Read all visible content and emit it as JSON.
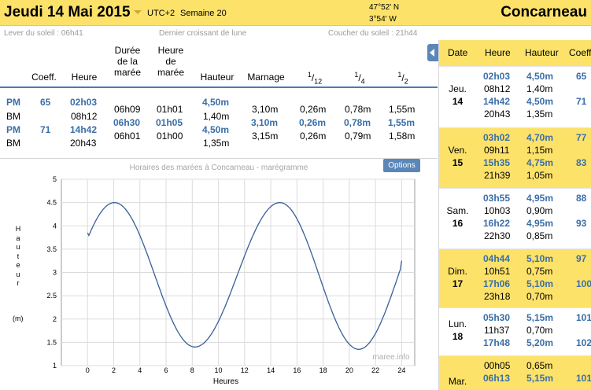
{
  "header": {
    "date": "Jeudi 14 Mai 2015",
    "timezone": "UTC+2",
    "week": "Semaine 20",
    "lat": "47°52' N",
    "lon": "3°54' W",
    "city": "Concarneau"
  },
  "sun": {
    "sunrise": "Lever du soleil : 06h41",
    "moon": "Dernier croissant de lune",
    "sunset": "Coucher du soleil : 21h44"
  },
  "table": {
    "headers": {
      "coeff": "Coeff.",
      "heure": "Heure",
      "duree": [
        "Durée",
        "de la",
        "marée"
      ],
      "heure_maree": [
        "Heure",
        "de",
        "marée"
      ],
      "hauteur": "Hauteur",
      "marnage": "Marnage",
      "f12": [
        "1",
        "12"
      ],
      "f14": [
        "1",
        "4"
      ],
      "f12b": [
        "1",
        "2"
      ]
    },
    "rows": [
      {
        "type": "PM",
        "coeff": "65",
        "heure": "02h03",
        "duree": "06h09",
        "heure_maree": "01h01",
        "hauteur": "4,50m",
        "marnage": "3,10m",
        "d12": "0,26m",
        "d4": "0,78m",
        "d2": "1,55m"
      },
      {
        "type": "BM",
        "coeff": "",
        "heure": "08h12",
        "duree": "06h30",
        "heure_maree": "01h05",
        "hauteur": "1,40m",
        "marnage": "3,10m",
        "d12": "0,26m",
        "d4": "0,78m",
        "d2": "1,55m"
      },
      {
        "type": "PM",
        "coeff": "71",
        "heure": "14h42",
        "duree": "06h01",
        "heure_maree": "01h00",
        "hauteur": "4,50m",
        "marnage": "3,15m",
        "d12": "0,26m",
        "d4": "0,79m",
        "d2": "1,58m"
      },
      {
        "type": "BM",
        "coeff": "",
        "heure": "20h43",
        "duree": "",
        "heure_maree": "",
        "hauteur": "1,35m",
        "marnage": "",
        "d12": "",
        "d4": "",
        "d2": ""
      }
    ]
  },
  "chart": {
    "title": "Horaires des marées à Concarneau - marégramme",
    "options_label": "Options",
    "watermark": "maree.info"
  },
  "chart_data": {
    "type": "line",
    "title": "Horaires des marées à Concarneau - marégramme",
    "xlabel": "Heures",
    "ylabel": "Hauteur (m)",
    "xlim": [
      -2,
      25
    ],
    "ylim": [
      1,
      5
    ],
    "xticks": [
      0,
      2,
      4,
      6,
      8,
      10,
      12,
      14,
      16,
      18,
      20,
      22,
      24
    ],
    "yticks": [
      1,
      1.5,
      2,
      2.5,
      3,
      3.5,
      4,
      4.5,
      5
    ],
    "grid": true,
    "series": [
      {
        "color": "#3a5f96",
        "extrema": [
          {
            "x": 2.05,
            "y": 4.5
          },
          {
            "x": 8.2,
            "y": 1.4
          },
          {
            "x": 14.7,
            "y": 4.5
          },
          {
            "x": 20.72,
            "y": 1.35
          }
        ],
        "x": [
          0,
          24
        ],
        "start_y": 3.85,
        "end_y": 3.25
      }
    ]
  },
  "side": {
    "headers": {
      "date": "Date",
      "heure": "Heure",
      "hauteur": "Hauteur",
      "coeff": "Coeff"
    },
    "days": [
      {
        "day": "Jeu.",
        "num": "14",
        "highlight": false,
        "rows": [
          {
            "heure": "02h03",
            "hauteur": "4,50m",
            "coeff": "65",
            "pm": true
          },
          {
            "heure": "08h12",
            "hauteur": "1,40m",
            "coeff": "",
            "pm": false
          },
          {
            "heure": "14h42",
            "hauteur": "4,50m",
            "coeff": "71",
            "pm": true
          },
          {
            "heure": "20h43",
            "hauteur": "1,35m",
            "coeff": "",
            "pm": false
          }
        ]
      },
      {
        "day": "Ven.",
        "num": "15",
        "highlight": true,
        "rows": [
          {
            "heure": "03h02",
            "hauteur": "4,70m",
            "coeff": "77",
            "pm": true
          },
          {
            "heure": "09h11",
            "hauteur": "1,15m",
            "coeff": "",
            "pm": false
          },
          {
            "heure": "15h35",
            "hauteur": "4,75m",
            "coeff": "83",
            "pm": true
          },
          {
            "heure": "21h39",
            "hauteur": "1,05m",
            "coeff": "",
            "pm": false
          }
        ]
      },
      {
        "day": "Sam.",
        "num": "16",
        "highlight": false,
        "rows": [
          {
            "heure": "03h55",
            "hauteur": "4,95m",
            "coeff": "88",
            "pm": true
          },
          {
            "heure": "10h03",
            "hauteur": "0,90m",
            "coeff": "",
            "pm": false
          },
          {
            "heure": "16h22",
            "hauteur": "4,95m",
            "coeff": "93",
            "pm": true
          },
          {
            "heure": "22h30",
            "hauteur": "0,85m",
            "coeff": "",
            "pm": false
          }
        ]
      },
      {
        "day": "Dim.",
        "num": "17",
        "highlight": true,
        "rows": [
          {
            "heure": "04h44",
            "hauteur": "5,10m",
            "coeff": "97",
            "pm": true
          },
          {
            "heure": "10h51",
            "hauteur": "0,75m",
            "coeff": "",
            "pm": false
          },
          {
            "heure": "17h06",
            "hauteur": "5,10m",
            "coeff": "100",
            "pm": true
          },
          {
            "heure": "23h18",
            "hauteur": "0,70m",
            "coeff": "",
            "pm": false
          }
        ]
      },
      {
        "day": "Lun.",
        "num": "18",
        "highlight": false,
        "rows": [
          {
            "heure": "05h30",
            "hauteur": "5,15m",
            "coeff": "101",
            "pm": true
          },
          {
            "heure": "11h37",
            "hauteur": "0,70m",
            "coeff": "",
            "pm": false
          },
          {
            "heure": "17h48",
            "hauteur": "5,20m",
            "coeff": "102",
            "pm": true
          }
        ]
      },
      {
        "day": "Mar.",
        "num": "",
        "highlight": true,
        "rows": [
          {
            "heure": "00h05",
            "hauteur": "0,65m",
            "coeff": "",
            "pm": false
          },
          {
            "heure": "06h13",
            "hauteur": "5,15m",
            "coeff": "101",
            "pm": true
          }
        ]
      }
    ]
  },
  "colors": {
    "yellow": "#fde26a",
    "blue": "#3a6ea8",
    "accent": "#5b86b8"
  }
}
